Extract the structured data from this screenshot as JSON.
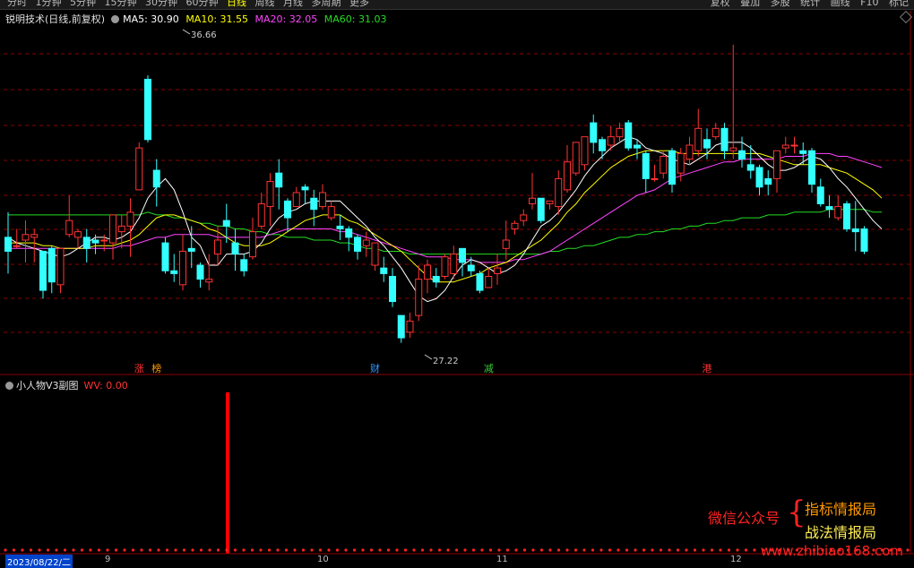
{
  "toolbar": {
    "left_tabs": [
      "分时",
      "1分钟",
      "5分钟",
      "15分钟",
      "30分钟",
      "60分钟",
      "日线",
      "周线",
      "月线",
      "多周期",
      "更多"
    ],
    "active_tab": "日线",
    "right_tools": [
      "复权",
      "叠加",
      "多股",
      "统计",
      "画线",
      "F10",
      "标记"
    ]
  },
  "main_panel": {
    "title": "锐明技术(日线,前复权)",
    "ma5_label": "MA5: 30.90",
    "ma10_label": "MA10: 31.55",
    "ma20_label": "MA20: 32.05",
    "ma60_label": "MA60: 31.03",
    "high_annotation": "36.66",
    "low_annotation": "27.22",
    "event_marks": [
      "涨",
      "榜",
      "财",
      "减",
      "港"
    ]
  },
  "sub_panel": {
    "title": "小人物V3副图",
    "value_label": "WV: 0.00"
  },
  "date_axis": {
    "current_date": "2023/08/22/二",
    "ticks": [
      "9",
      "10",
      "11",
      "12"
    ]
  },
  "watermark": {
    "left": "微信公众号",
    "right_top": "指标情报局",
    "right_bottom": "战法情报局",
    "url": "www.zhibiao168.com"
  },
  "colors": {
    "up": "#ff3333",
    "down": "#33ffff",
    "ma5": "#ffffff",
    "ma10": "#ffff00",
    "ma20": "#ff44ff",
    "ma60": "#22dd22",
    "grid": "#8b0000"
  },
  "chart_data": {
    "type": "candlestick",
    "title": "锐明技术(日线,前复权)",
    "y_range": [
      26.6,
      38.6
    ],
    "candles": [
      [
        31.0,
        30.5,
        31.9,
        29.7
      ],
      [
        30.7,
        30.7,
        31.3,
        30.6
      ],
      [
        30.9,
        31.1,
        31.6,
        30.1
      ],
      [
        31.0,
        31.1,
        31.3,
        30.1
      ],
      [
        30.5,
        29.1,
        30.5,
        28.8
      ],
      [
        30.6,
        29.4,
        30.7,
        29.0
      ],
      [
        29.3,
        30.6,
        30.6,
        29.0
      ],
      [
        31.1,
        31.6,
        32.5,
        31.0
      ],
      [
        31.0,
        31.2,
        31.3,
        30.6
      ],
      [
        31.0,
        30.6,
        31.3,
        30.1
      ],
      [
        30.9,
        30.8,
        31.1,
        30.4
      ],
      [
        30.9,
        30.9,
        31.1,
        30.5
      ],
      [
        30.8,
        31.8,
        31.8,
        30.2
      ],
      [
        31.2,
        31.4,
        31.8,
        30.6
      ],
      [
        31.4,
        31.9,
        32.4,
        30.3
      ],
      [
        32.7,
        34.2,
        34.4,
        32.7
      ],
      [
        36.66,
        34.5,
        36.8,
        34.4
      ],
      [
        33.4,
        32.8,
        33.8,
        32.1
      ],
      [
        30.8,
        29.8,
        31.0,
        29.7
      ],
      [
        29.8,
        29.7,
        30.4,
        29.4
      ],
      [
        29.3,
        30.5,
        31.1,
        29.1
      ],
      [
        30.6,
        30.5,
        31.4,
        29.9
      ],
      [
        30.0,
        29.5,
        30.1,
        29.2
      ],
      [
        29.4,
        29.5,
        30.4,
        29.1
      ],
      [
        30.4,
        30.9,
        31.4,
        30.0
      ],
      [
        31.6,
        31.4,
        32.2,
        30.8
      ],
      [
        30.8,
        30.4,
        31.3,
        29.8
      ],
      [
        30.2,
        29.8,
        30.4,
        29.6
      ],
      [
        30.3,
        31.2,
        31.7,
        30.2
      ],
      [
        31.4,
        32.2,
        32.6,
        31.3
      ],
      [
        32.1,
        33.0,
        33.3,
        31.4
      ],
      [
        33.3,
        32.8,
        33.8,
        32.0
      ],
      [
        32.3,
        31.7,
        32.4,
        31.2
      ],
      [
        32.1,
        32.6,
        32.8,
        32.1
      ],
      [
        32.8,
        32.7,
        32.9,
        32.2
      ],
      [
        32.4,
        32.0,
        32.7,
        31.4
      ],
      [
        32.1,
        32.6,
        32.9,
        32.0
      ],
      [
        31.7,
        32.1,
        32.3,
        31.6
      ],
      [
        31.4,
        31.3,
        31.8,
        30.9
      ],
      [
        31.3,
        31.0,
        31.4,
        30.5
      ],
      [
        31.0,
        30.5,
        31.1,
        30.2
      ],
      [
        30.7,
        30.9,
        31.2,
        30.3
      ],
      [
        30.0,
        30.8,
        30.8,
        29.8
      ],
      [
        29.9,
        29.7,
        30.3,
        29.4
      ],
      [
        29.6,
        28.7,
        29.9,
        28.5
      ],
      [
        28.2,
        27.4,
        28.2,
        27.22
      ],
      [
        27.6,
        28.0,
        28.3,
        27.4
      ],
      [
        28.2,
        29.5,
        30.0,
        28.0
      ],
      [
        29.5,
        30.0,
        30.2,
        29.0
      ],
      [
        29.6,
        29.4,
        29.9,
        29.2
      ],
      [
        29.6,
        30.3,
        30.4,
        29.5
      ],
      [
        29.7,
        30.4,
        30.7,
        29.5
      ],
      [
        30.6,
        30.1,
        30.6,
        29.6
      ],
      [
        30.0,
        29.8,
        30.3,
        29.6
      ],
      [
        29.7,
        29.1,
        29.8,
        29.0
      ],
      [
        29.2,
        29.6,
        29.9,
        29.2
      ],
      [
        29.7,
        29.9,
        30.4,
        29.3
      ],
      [
        30.6,
        30.9,
        31.6,
        30.2
      ],
      [
        31.3,
        31.5,
        31.6,
        31.1
      ],
      [
        31.6,
        31.8,
        32.0,
        31.4
      ],
      [
        32.2,
        32.4,
        33.3,
        32.0
      ],
      [
        32.4,
        31.6,
        32.4,
        31.5
      ],
      [
        32.2,
        32.3,
        32.3,
        32.0
      ],
      [
        32.1,
        33.1,
        33.4,
        31.8
      ],
      [
        32.7,
        33.7,
        34.3,
        32.6
      ],
      [
        33.3,
        34.4,
        34.4,
        33.2
      ],
      [
        33.6,
        34.6,
        34.6,
        33.4
      ],
      [
        35.1,
        34.4,
        35.4,
        34.0
      ],
      [
        34.5,
        34.1,
        34.6,
        33.8
      ],
      [
        34.3,
        34.6,
        35.0,
        34.1
      ],
      [
        34.6,
        34.9,
        35.1,
        34.4
      ],
      [
        35.1,
        34.2,
        35.2,
        34.1
      ],
      [
        34.3,
        34.2,
        34.5,
        33.8
      ],
      [
        34.0,
        33.1,
        34.1,
        32.6
      ],
      [
        33.1,
        33.1,
        33.6,
        33.0
      ],
      [
        33.3,
        33.9,
        34.1,
        33.1
      ],
      [
        34.1,
        32.9,
        34.2,
        32.6
      ],
      [
        33.3,
        34.0,
        34.2,
        33.0
      ],
      [
        33.8,
        34.3,
        34.6,
        33.6
      ],
      [
        34.1,
        34.9,
        35.6,
        33.9
      ],
      [
        34.5,
        34.2,
        34.9,
        33.8
      ],
      [
        34.6,
        34.9,
        35.1,
        34.5
      ],
      [
        34.9,
        34.1,
        35.1,
        33.8
      ],
      [
        34.1,
        34.2,
        37.9,
        33.8
      ],
      [
        34.1,
        33.8,
        34.6,
        33.5
      ],
      [
        33.6,
        33.4,
        34.3,
        33.1
      ],
      [
        33.5,
        32.8,
        33.6,
        32.5
      ],
      [
        33.1,
        32.9,
        33.4,
        32.5
      ],
      [
        33.1,
        34.1,
        34.1,
        32.6
      ],
      [
        34.2,
        34.3,
        34.6,
        34.0
      ],
      [
        34.3,
        34.3,
        34.6,
        34.0
      ],
      [
        34.1,
        34.0,
        34.4,
        33.6
      ],
      [
        34.1,
        32.9,
        34.2,
        32.6
      ],
      [
        32.8,
        32.2,
        33.1,
        32.1
      ],
      [
        32.1,
        32.0,
        32.5,
        31.7
      ],
      [
        31.7,
        32.1,
        32.5,
        31.6
      ],
      [
        32.2,
        31.3,
        32.3,
        31.2
      ],
      [
        31.3,
        31.2,
        32.3,
        30.5
      ],
      [
        31.3,
        30.5,
        31.4,
        30.4
      ]
    ],
    "ma5": [
      31.0,
      30.8,
      30.7,
      30.6,
      30.5,
      30.4,
      30.3,
      30.4,
      30.6,
      30.8,
      31.0,
      31.0,
      30.9,
      31.0,
      31.2,
      31.7,
      32.4,
      32.8,
      33.1,
      32.7,
      31.9,
      31.0,
      30.7,
      30.0,
      30.0,
      30.4,
      30.4,
      30.4,
      30.5,
      30.8,
      31.3,
      31.7,
      31.9,
      32.0,
      32.2,
      32.3,
      32.3,
      32.3,
      32.3,
      32.0,
      31.7,
      31.4,
      31.0,
      30.7,
      30.3,
      29.9,
      29.4,
      28.9,
      28.7,
      28.8,
      29.1,
      29.6,
      30.0,
      30.2,
      30.1,
      29.9,
      29.7,
      29.8,
      30.0,
      30.4,
      30.9,
      31.4,
      31.6,
      31.9,
      32.3,
      32.7,
      33.2,
      33.6,
      33.9,
      34.2,
      34.4,
      34.6,
      34.5,
      34.2,
      34.1,
      34.0,
      33.8,
      33.7,
      33.6,
      33.8,
      34.0,
      34.3,
      34.4,
      34.4,
      34.4,
      34.2,
      33.9,
      33.6,
      33.4,
      33.4,
      33.5,
      33.7,
      33.9,
      33.8,
      33.5,
      33.1,
      32.8,
      32.4,
      32.0,
      31.6,
      31.3
    ],
    "ma10": [
      30.8,
      30.8,
      30.8,
      30.8,
      30.7,
      30.7,
      30.6,
      30.6,
      30.6,
      30.6,
      30.7,
      30.7,
      30.7,
      30.8,
      30.9,
      31.1,
      31.4,
      31.7,
      31.8,
      31.8,
      31.7,
      31.6,
      31.5,
      31.3,
      31.2,
      31.0,
      30.8,
      30.7,
      30.7,
      30.7,
      30.8,
      31.0,
      31.2,
      31.4,
      31.6,
      31.7,
      31.8,
      31.8,
      31.8,
      31.6,
      31.5,
      31.3,
      31.1,
      30.9,
      30.7,
      30.5,
      30.2,
      29.9,
      29.6,
      29.4,
      29.4,
      29.4,
      29.5,
      29.6,
      29.7,
      29.9,
      30.0,
      30.1,
      30.3,
      30.5,
      30.7,
      30.9,
      31.2,
      31.5,
      31.9,
      32.2,
      32.6,
      32.9,
      33.2,
      33.5,
      33.7,
      33.9,
      34.0,
      34.1,
      34.1,
      34.1,
      34.1,
      34.0,
      34.0,
      34.0,
      34.0,
      34.0,
      34.0,
      34.0,
      34.0,
      34.0,
      34.0,
      33.9,
      33.8,
      33.7,
      33.6,
      33.6,
      33.6,
      33.6,
      33.5,
      33.4,
      33.3,
      33.1,
      32.9,
      32.7,
      32.4
    ],
    "ma20": [
      30.6,
      30.6,
      30.6,
      30.6,
      30.6,
      30.6,
      30.6,
      30.6,
      30.6,
      30.6,
      30.6,
      30.6,
      30.6,
      30.7,
      30.7,
      30.8,
      30.9,
      31.0,
      31.0,
      31.1,
      31.1,
      31.1,
      31.1,
      31.1,
      31.0,
      31.0,
      31.0,
      31.0,
      31.0,
      31.0,
      31.1,
      31.2,
      31.3,
      31.3,
      31.3,
      31.3,
      31.3,
      31.3,
      31.2,
      31.2,
      31.1,
      31.0,
      30.9,
      30.8,
      30.7,
      30.6,
      30.5,
      30.4,
      30.3,
      30.3,
      30.3,
      30.2,
      30.2,
      30.2,
      30.1,
      30.1,
      30.1,
      30.1,
      30.2,
      30.2,
      30.3,
      30.4,
      30.5,
      30.7,
      30.9,
      31.1,
      31.3,
      31.5,
      31.7,
      31.9,
      32.1,
      32.3,
      32.5,
      32.6,
      32.7,
      32.9,
      33.1,
      33.2,
      33.3,
      33.4,
      33.5,
      33.6,
      33.7,
      33.7,
      33.8,
      33.8,
      33.8,
      33.8,
      33.8,
      33.9,
      33.9,
      33.9,
      34.0,
      34.0,
      34.0,
      33.9,
      33.9,
      33.8,
      33.7,
      33.6,
      33.5
    ],
    "ma60": [
      31.8,
      31.8,
      31.8,
      31.8,
      31.8,
      31.8,
      31.8,
      31.8,
      31.8,
      31.8,
      31.8,
      31.8,
      31.8,
      31.8,
      31.8,
      31.8,
      31.9,
      31.8,
      31.8,
      31.7,
      31.7,
      31.6,
      31.5,
      31.5,
      31.4,
      31.4,
      31.3,
      31.3,
      31.2,
      31.2,
      31.1,
      31.1,
      31.0,
      31.0,
      31.0,
      30.9,
      30.9,
      30.9,
      30.8,
      30.8,
      30.7,
      30.6,
      30.6,
      30.5,
      30.5,
      30.5,
      30.4,
      30.4,
      30.4,
      30.4,
      30.4,
      30.4,
      30.4,
      30.4,
      30.4,
      30.4,
      30.4,
      30.4,
      30.4,
      30.4,
      30.4,
      30.4,
      30.5,
      30.5,
      30.6,
      30.6,
      30.7,
      30.7,
      30.8,
      30.9,
      31.0,
      31.0,
      31.1,
      31.1,
      31.2,
      31.2,
      31.3,
      31.3,
      31.4,
      31.4,
      31.5,
      31.5,
      31.6,
      31.6,
      31.7,
      31.7,
      31.7,
      31.8,
      31.8,
      31.8,
      31.9,
      31.9,
      31.9,
      31.9,
      32.0,
      32.0,
      32.0,
      32.0,
      32.0,
      31.9,
      31.9
    ],
    "signal_bar_index": 20,
    "signal_bar_value": 1,
    "event_mark_indices": [
      15,
      17,
      42,
      55,
      80
    ]
  }
}
